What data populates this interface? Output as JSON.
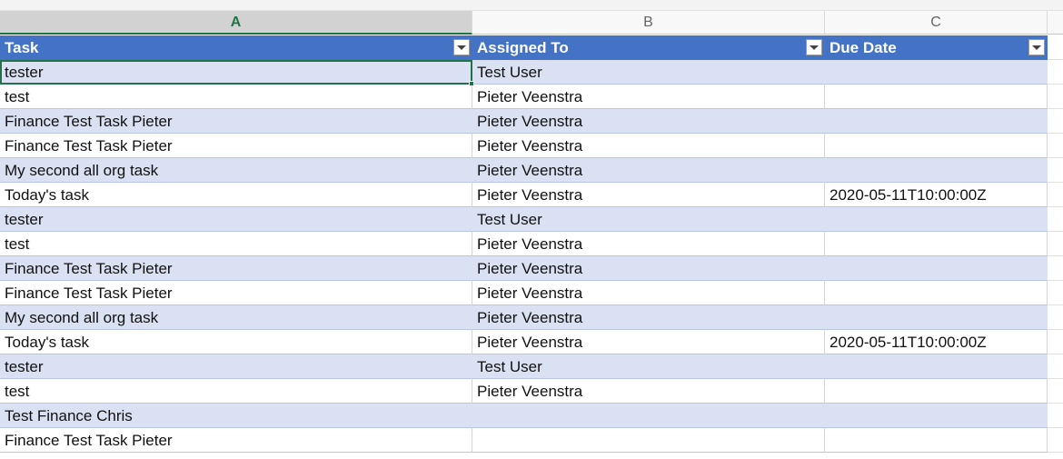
{
  "column_headers": [
    "A",
    "B",
    "C"
  ],
  "selected_column": "A",
  "table": {
    "header": [
      "Task",
      "Assigned To",
      "Due Date"
    ],
    "rows": [
      [
        "tester",
        "Test User",
        ""
      ],
      [
        "test",
        "Pieter Veenstra",
        ""
      ],
      [
        "Finance Test Task Pieter",
        "Pieter Veenstra",
        ""
      ],
      [
        "Finance Test Task Pieter",
        "Pieter Veenstra",
        ""
      ],
      [
        "My second all org task",
        "Pieter Veenstra",
        ""
      ],
      [
        "Today's task",
        "Pieter Veenstra",
        "2020-05-11T10:00:00Z"
      ],
      [
        "tester",
        "Test User",
        ""
      ],
      [
        "test",
        "Pieter Veenstra",
        ""
      ],
      [
        "Finance Test Task Pieter",
        "Pieter Veenstra",
        ""
      ],
      [
        "Finance Test Task Pieter",
        "Pieter Veenstra",
        ""
      ],
      [
        "My second all org task",
        "Pieter Veenstra",
        ""
      ],
      [
        "Today's task",
        "Pieter Veenstra",
        "2020-05-11T10:00:00Z"
      ],
      [
        "tester",
        "Test User",
        ""
      ],
      [
        "test",
        "Pieter Veenstra",
        ""
      ],
      [
        "Test Finance Chris",
        "",
        ""
      ],
      [
        "Finance Test Task Pieter",
        "",
        ""
      ]
    ]
  },
  "colors": {
    "header_fill": "#4472c4",
    "band_fill": "#d9e1f2",
    "selection": "#217346"
  },
  "icons": {
    "filter": "filter-dropdown-icon"
  }
}
